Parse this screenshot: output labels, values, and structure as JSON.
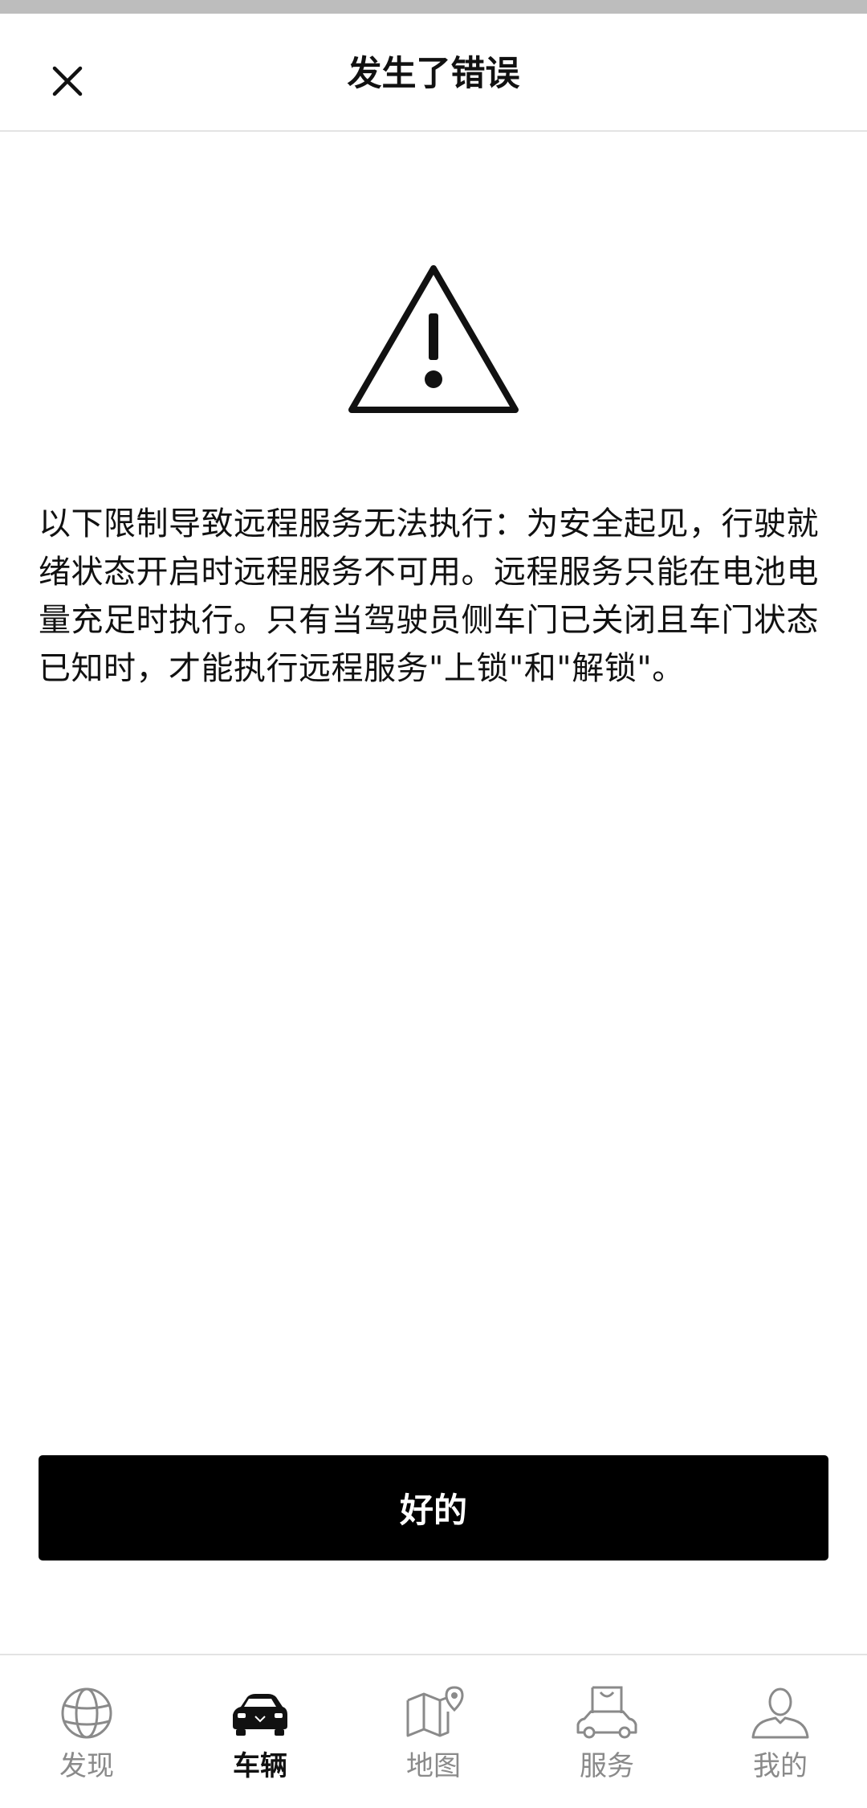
{
  "header": {
    "title": "发生了错误"
  },
  "error": {
    "message": "以下限制导致远程服务无法执行：为安全起见，行驶就绪状态开启时远程服务不可用。远程服务只能在电池电量充足时执行。只有当驾驶员侧车门已关闭且车门状态已知时，才能执行远程服务\"上锁\"和\"解锁\"。"
  },
  "actions": {
    "ok_label": "好的"
  },
  "tabbar": {
    "active": "vehicle",
    "items": [
      {
        "id": "discover",
        "label": "发现",
        "icon": "globe-icon"
      },
      {
        "id": "vehicle",
        "label": "车辆",
        "icon": "car-icon"
      },
      {
        "id": "map",
        "label": "地图",
        "icon": "map-icon"
      },
      {
        "id": "service",
        "label": "服务",
        "icon": "shopping-bag-car-icon"
      },
      {
        "id": "me",
        "label": "我的",
        "icon": "person-icon"
      }
    ]
  },
  "colors": {
    "primary": "#000000",
    "inactive": "#8a8a8a",
    "divider": "#e3e3e3"
  }
}
